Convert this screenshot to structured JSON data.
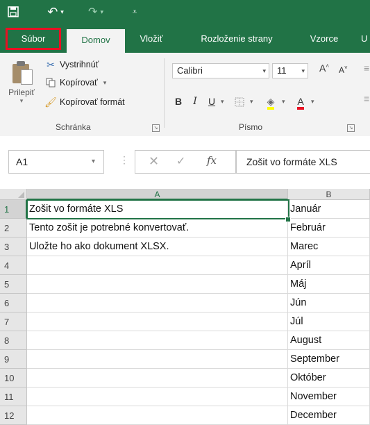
{
  "ribbon_tabs": {
    "subor": "Súbor",
    "domov": "Domov",
    "vlozit": "Vložiť",
    "rozlozenie": "Rozloženie strany",
    "vzorce": "Vzorce",
    "more": "U"
  },
  "clipboard": {
    "paste_label": "Prilepiť",
    "cut_label": "Vystrihnúť",
    "copy_label": "Kopírovať",
    "format_painter_label": "Kopírovať formát",
    "group_label": "Schránka"
  },
  "font": {
    "name": "Calibri",
    "size": "11",
    "bold": "B",
    "italic": "I",
    "underline": "U",
    "font_color_glyph": "A",
    "group_label": "Písmo"
  },
  "formula_bar": {
    "name_box": "A1",
    "value": "Zošit vo formáte XLS"
  },
  "columns": [
    "A",
    "B"
  ],
  "rows": [
    {
      "num": "1",
      "a": "Zošit vo formáte XLS",
      "b": "Január"
    },
    {
      "num": "2",
      "a": "Tento zošit je potrebné konvertovať.",
      "b": "Február"
    },
    {
      "num": "3",
      "a": "Uložte ho ako dokument XLSX.",
      "b": "Marec"
    },
    {
      "num": "4",
      "a": "",
      "b": "Apríl"
    },
    {
      "num": "5",
      "a": "",
      "b": "Máj"
    },
    {
      "num": "6",
      "a": "",
      "b": "Jún"
    },
    {
      "num": "7",
      "a": "",
      "b": "Júl"
    },
    {
      "num": "8",
      "a": "",
      "b": "August"
    },
    {
      "num": "9",
      "a": "",
      "b": "September"
    },
    {
      "num": "10",
      "a": "",
      "b": "Október"
    },
    {
      "num": "11",
      "a": "",
      "b": "November"
    },
    {
      "num": "12",
      "a": "",
      "b": "December"
    }
  ],
  "colors": {
    "accent": "#217346",
    "highlight": "#e81123"
  }
}
